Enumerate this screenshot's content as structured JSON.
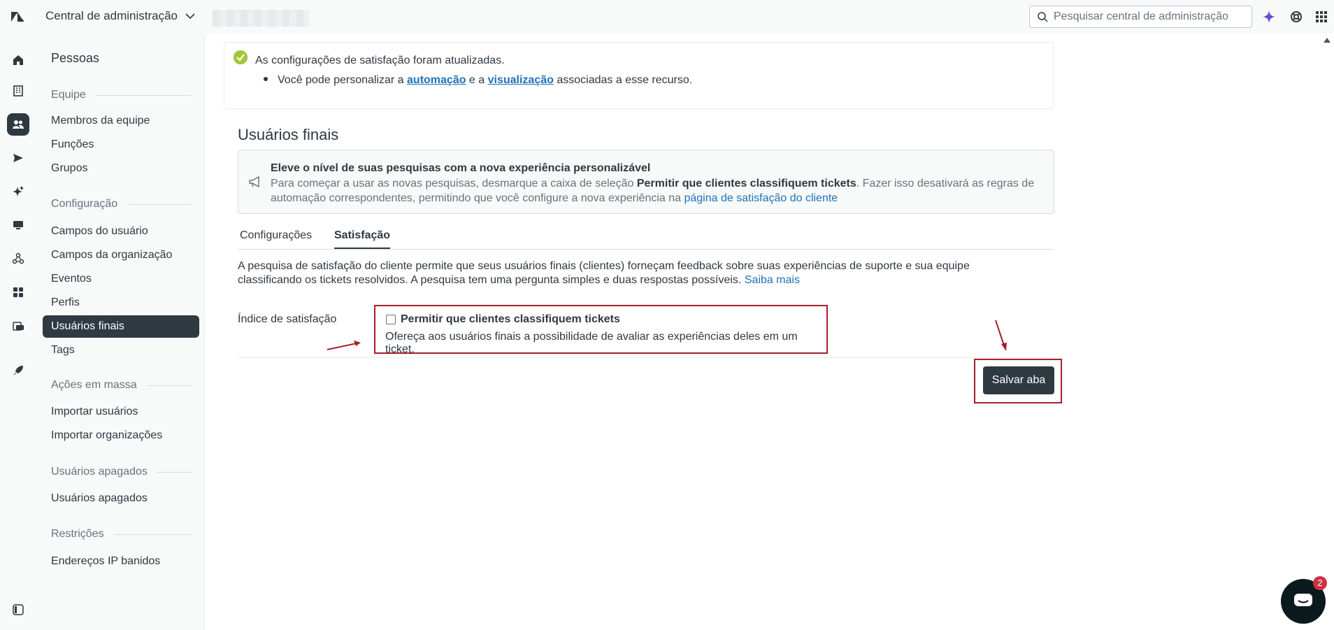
{
  "topbar": {
    "product_name": "Central de administração",
    "search_placeholder": "Pesquisar central de administração"
  },
  "sidebar": {
    "title": "Pessoas",
    "sections": [
      {
        "label": "Equipe",
        "items": [
          "Membros da equipe",
          "Funções",
          "Grupos"
        ]
      },
      {
        "label": "Configuração",
        "items": [
          "Campos do usuário",
          "Campos da organização",
          "Eventos",
          "Perfis",
          "Usuários finais",
          "Tags"
        ]
      },
      {
        "label": "Ações em massa",
        "items": [
          "Importar usuários",
          "Importar organizações"
        ]
      },
      {
        "label": "Usuários apagados",
        "items": [
          "Usuários apagados"
        ]
      },
      {
        "label": "Restrições",
        "items": [
          "Endereços IP banidos"
        ]
      }
    ],
    "active_item": "Usuários finais"
  },
  "alert": {
    "title": "As configurações de satisfação foram atualizadas.",
    "bullet_prefix": "Você pode personalizar a ",
    "link_automation": "automação",
    "bullet_mid": " e a ",
    "link_view": "visualização",
    "bullet_suffix": " associadas a esse recurso."
  },
  "page": {
    "title": "Usuários finais"
  },
  "promo": {
    "title": "Eleve o nível de suas pesquisas com a nova experiência personalizável",
    "body_prefix": "Para começar a usar as novas pesquisas, desmarque a caixa de seleção ",
    "body_bold": "Permitir que clientes classifiquem tickets",
    "body_mid": ". Fazer isso desativará as regras de automação correspondentes, permitindo que você configure a nova experiência na ",
    "body_link": "página de satisfação do cliente"
  },
  "tabs": [
    "Configurações",
    "Satisfação"
  ],
  "selected_tab": "Satisfação",
  "description": {
    "text": "A pesquisa de satisfação do cliente permite que seus usuários finais (clientes) forneçam feedback sobre suas experiências de suporte e sua equipe classificando os tickets resolvidos. A pesquisa tem uma pergunta simples e duas respostas possíveis. ",
    "link": "Saiba mais"
  },
  "satisfaction_field": {
    "label": "Índice de satisfação",
    "checkbox_label": "Permitir que clientes classifiquem tickets",
    "checked": false,
    "hint": "Ofereça aos usuários finais a possibilidade de avaliar as experiências deles em um ticket."
  },
  "save_button": "Salvar aba",
  "chat": {
    "badge_count": "2"
  },
  "colors": {
    "annotation": "#a4202c",
    "link": "#1f73b7",
    "dark": "#2f3941",
    "success": "#5eae91"
  }
}
